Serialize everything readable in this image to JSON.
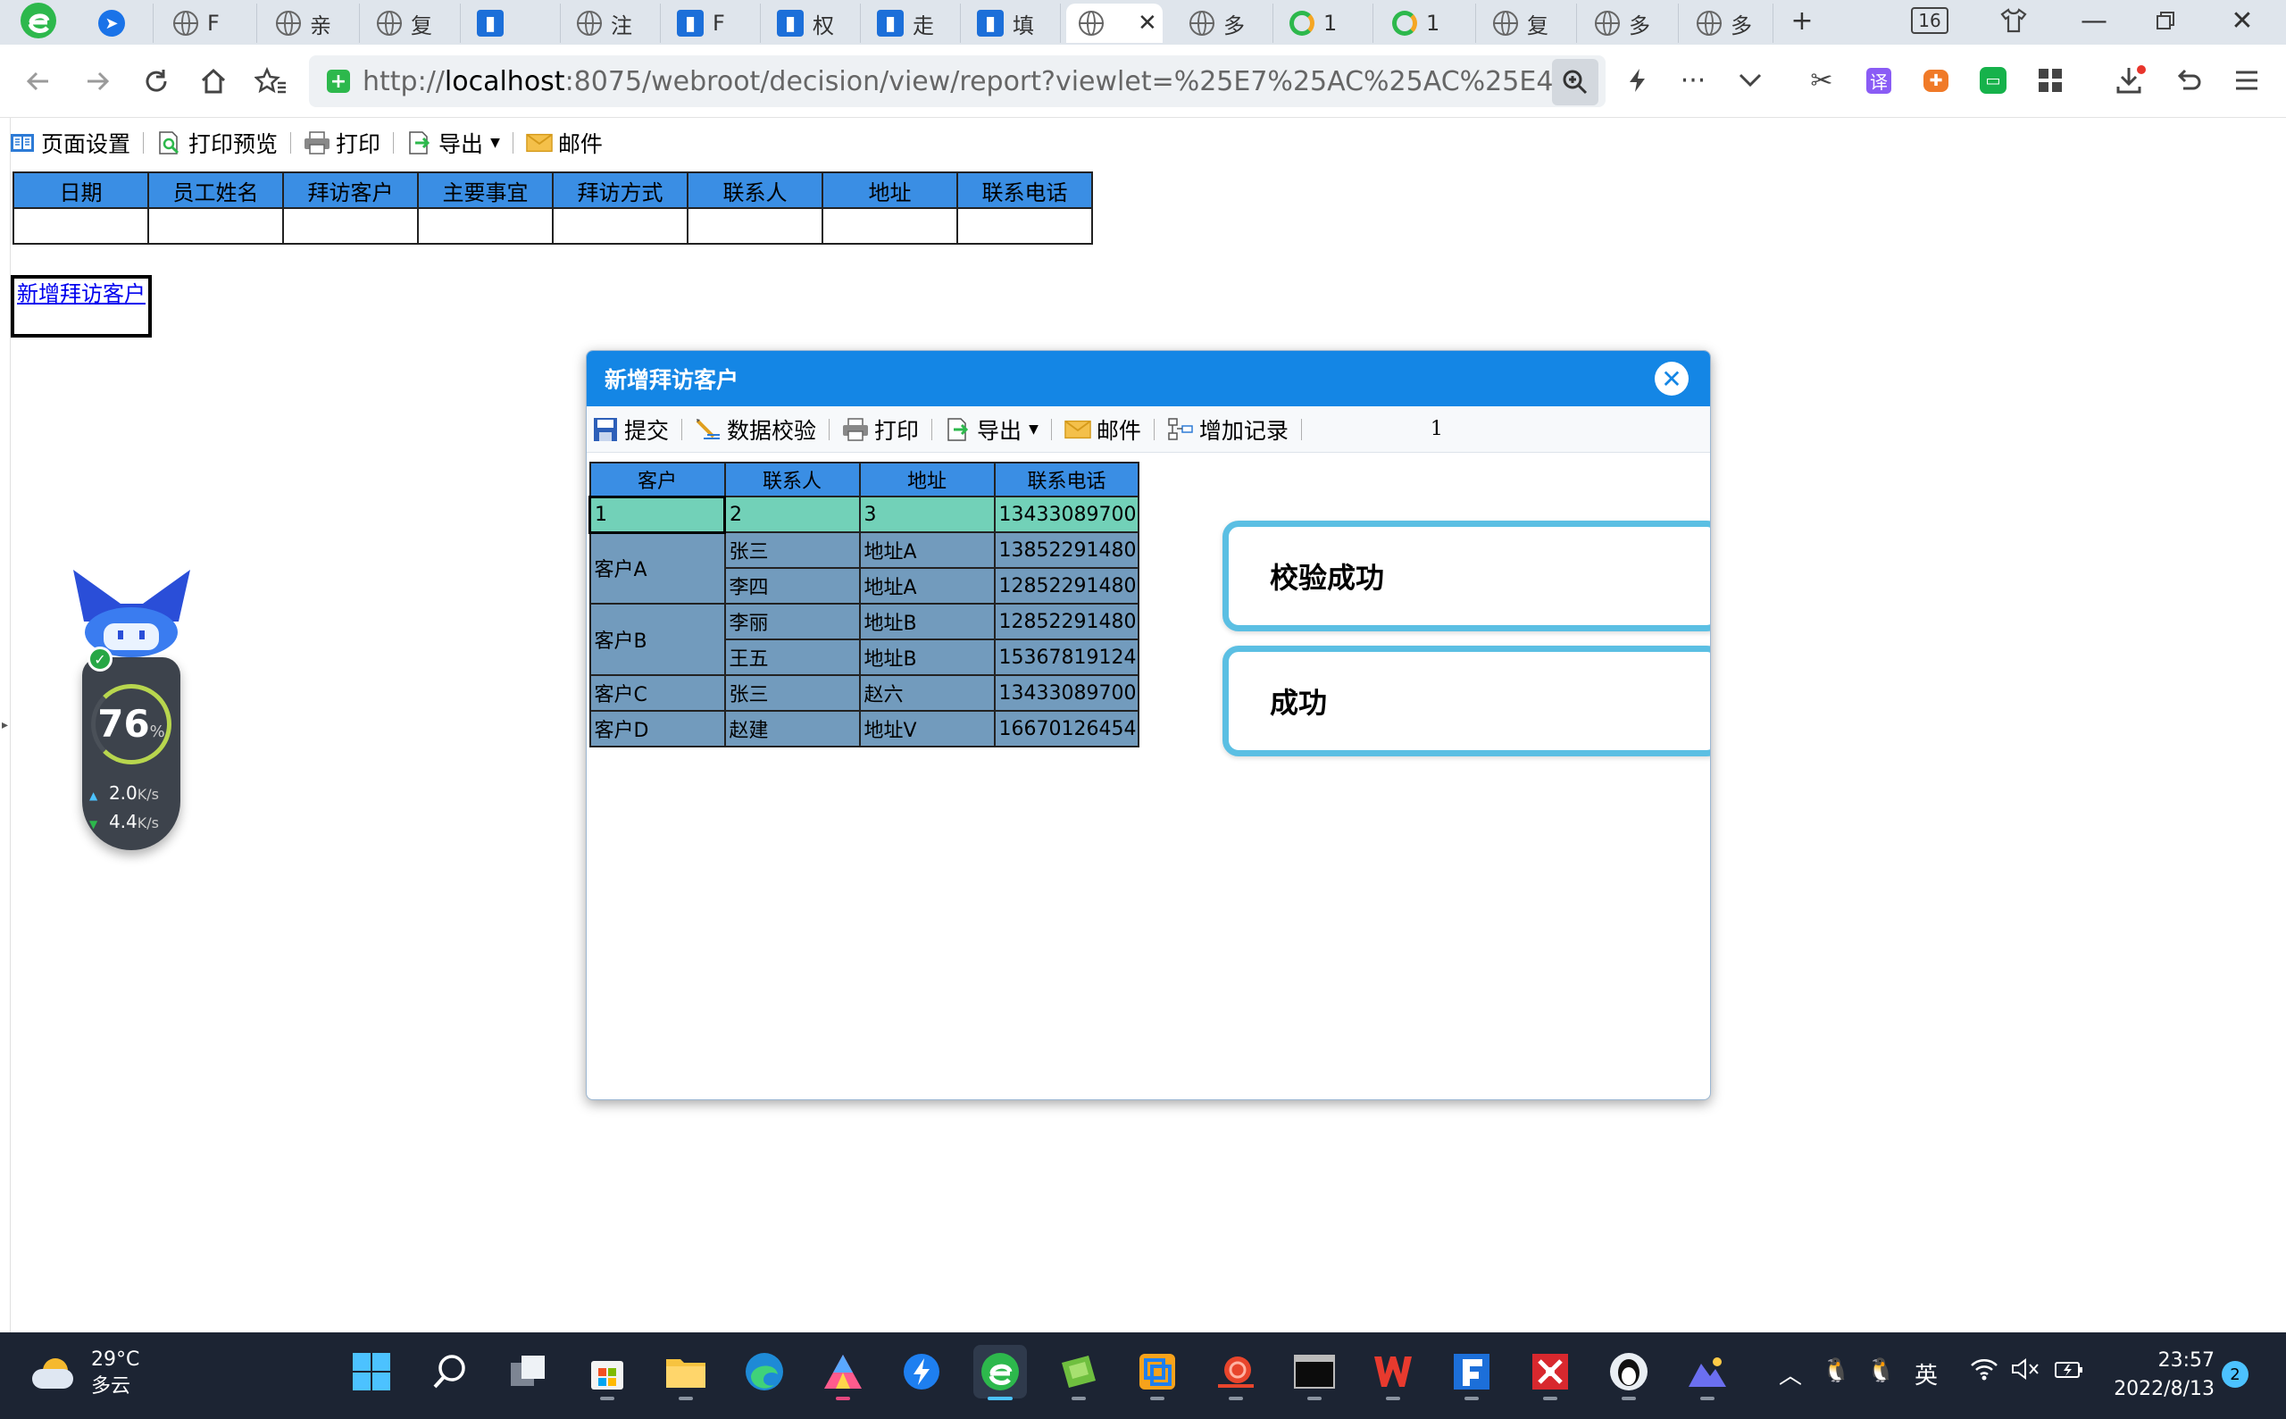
{
  "browser": {
    "tabs": [
      {
        "icon": "arrow",
        "label": ""
      },
      {
        "icon": "globe",
        "label": "F"
      },
      {
        "icon": "globe",
        "label": "亲"
      },
      {
        "icon": "globe",
        "label": "复"
      },
      {
        "icon": "finereport",
        "label": ""
      },
      {
        "icon": "globe",
        "label": "注"
      },
      {
        "icon": "finereport",
        "label": "F"
      },
      {
        "icon": "finereport",
        "label": "权"
      },
      {
        "icon": "finereport",
        "label": "走"
      },
      {
        "icon": "finereport",
        "label": "填"
      },
      {
        "icon": "globe",
        "label": ""
      },
      {
        "icon": "globe",
        "label": "多"
      },
      {
        "icon": "q",
        "label": "1"
      },
      {
        "icon": "q",
        "label": "1"
      },
      {
        "icon": "globe",
        "label": "复"
      },
      {
        "icon": "globe",
        "label": "多"
      },
      {
        "icon": "globe",
        "label": "多"
      }
    ],
    "tab_count": "16",
    "url_host": "localhost",
    "url_prefix": "http://",
    "url_rest": ":8075/webroot/decision/view/report?viewlet=%25E7%25AC%25AC%25E4%25B8%25"
  },
  "report_toolbar": {
    "page_setup": "页面设置",
    "print_preview": "打印预览",
    "print": "打印",
    "export": "导出",
    "mail": "邮件"
  },
  "report_table": {
    "headers": [
      "日期",
      "员工姓名",
      "拜访客户",
      "主要事宜",
      "拜访方式",
      "联系人",
      "地址",
      "联系电话"
    ]
  },
  "add_link": "新增拜访客户",
  "net_widget": {
    "percent": "76",
    "percent_unit": "%",
    "up_rate": "2.0",
    "down_rate": "4.4",
    "rate_unit": "K/s"
  },
  "dialog": {
    "title": "新增拜访客户",
    "toolbar": {
      "submit": "提交",
      "validate": "数据校验",
      "print": "打印",
      "export": "导出",
      "mail": "邮件",
      "add_record": "增加记录",
      "page": "1"
    },
    "table": {
      "headers": [
        "客户",
        "联系人",
        "地址",
        "联系电话"
      ],
      "new_row": [
        "1",
        "2",
        "3",
        "13433089700"
      ],
      "groups": [
        {
          "customer": "客户A",
          "rows": [
            {
              "contact": "张三",
              "address": "地址A",
              "phone": "13852291480"
            },
            {
              "contact": "李四",
              "address": "地址A",
              "phone": "12852291480"
            }
          ]
        },
        {
          "customer": "客户B",
          "rows": [
            {
              "contact": "李丽",
              "address": "地址B",
              "phone": "12852291480"
            },
            {
              "contact": "王五",
              "address": "地址B",
              "phone": "15367819124"
            }
          ]
        },
        {
          "customer": "客户C",
          "rows": [
            {
              "contact": "张三",
              "address": "赵六",
              "phone": "13433089700"
            }
          ]
        },
        {
          "customer": "客户D",
          "rows": [
            {
              "contact": "赵建",
              "address": "地址V",
              "phone": "16670126454"
            }
          ]
        }
      ]
    },
    "toasts": [
      "校验成功",
      "成功"
    ]
  },
  "taskbar": {
    "temperature": "29°C",
    "weather": "多云",
    "ime": "英",
    "time": "23:57",
    "date": "2022/8/13",
    "notifications": "2"
  },
  "colors": {
    "header_blue": "#3a8ee4",
    "dialog_title": "#1486e5",
    "row_new": "#72d1b8",
    "row_data": "#729bbd",
    "toast_border": "#5bbfe3"
  }
}
